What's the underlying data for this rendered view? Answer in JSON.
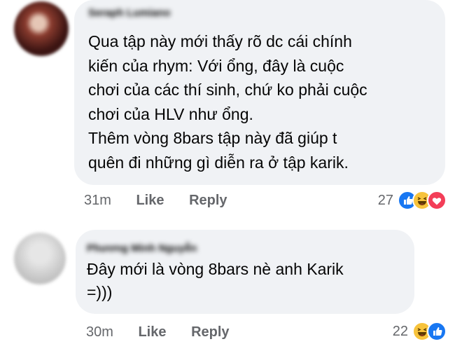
{
  "comments": [
    {
      "author": "Seraph Lumiano",
      "text": "Qua tập này mới thấy rõ dc cái chính\nkiến của rhym: Với ổng, đây là cuộc\nchơi của các thí sinh, chứ ko phải cuộc\nchơi của HLV như ổng.\nThêm vòng 8bars tập này đã giúp t\nquên đi những gì diễn ra ở tập karik.",
      "time": "31m",
      "like_label": "Like",
      "reply_label": "Reply",
      "reaction_count": "27",
      "reaction_icons": [
        "like-icon",
        "haha-icon",
        "love-icon"
      ]
    },
    {
      "author": "Phương Minh Nguyễn",
      "text": "Đây mới là vòng 8bars nè anh Karik\n=)))",
      "time": "30m",
      "like_label": "Like",
      "reply_label": "Reply",
      "reaction_count": "22",
      "reaction_icons": [
        "haha-icon",
        "like-icon"
      ]
    }
  ],
  "colors": {
    "bubble": "#f0f2f5",
    "secondary_text": "#65676b",
    "like": "#1877f2",
    "haha": "#f7c33c",
    "love": "#f33e58"
  }
}
